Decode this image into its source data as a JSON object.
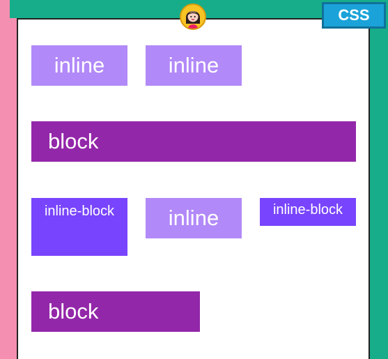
{
  "badge": {
    "label": "CSS"
  },
  "icons": {
    "avatar": "girl-avatar-icon"
  },
  "colors": {
    "pink_edge": "#f48fb1",
    "teal_frame": "#17ad8a",
    "badge": "#1ba3d9",
    "inline": "#b289f8",
    "block": "#9327a9",
    "inline_block": "#7844fd"
  },
  "boxes": [
    {
      "label": "inline",
      "kind": "inline"
    },
    {
      "label": "inline",
      "kind": "inline"
    },
    {
      "label": "block",
      "kind": "block"
    },
    {
      "label": "inline-block",
      "kind": "inline-block"
    },
    {
      "label": "inline",
      "kind": "inline"
    },
    {
      "label": "inline-block",
      "kind": "inline-block"
    },
    {
      "label": "block",
      "kind": "block"
    }
  ]
}
